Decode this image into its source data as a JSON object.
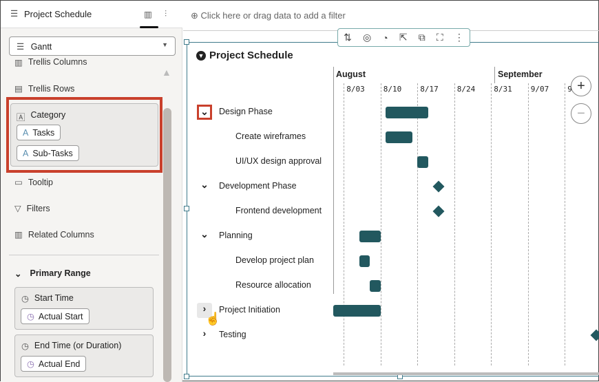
{
  "sidebar": {
    "title": "Project Schedule",
    "viz_type": "Gantt",
    "items": {
      "trellis_columns": "Trellis Columns",
      "trellis_rows": "Trellis Rows",
      "category": "Category",
      "tooltip": "Tooltip",
      "filters": "Filters",
      "related_columns": "Related Columns"
    },
    "category_pills": [
      "Tasks",
      "Sub-Tasks"
    ],
    "primary_range": {
      "title": "Primary Range",
      "start_label": "Start Time",
      "start_value": "Actual Start",
      "end_label": "End Time (or Duration)",
      "end_value": "Actual End"
    }
  },
  "filter_bar": {
    "placeholder": "Click here or drag data to add a filter"
  },
  "chart": {
    "title": "Project Schedule",
    "months": [
      "August",
      "September"
    ],
    "weeks": [
      "8/03",
      "8/10",
      "8/17",
      "8/24",
      "8/31",
      "9/07",
      "9/"
    ],
    "accent": "#22585f",
    "highlight": "#c9402c",
    "rows": [
      {
        "label": "Design Phase",
        "level": 0,
        "expander": "expanded",
        "start": "08-11",
        "end": "08-19"
      },
      {
        "label": "Create wireframes",
        "level": 1,
        "start": "08-11",
        "end": "08-16"
      },
      {
        "label": "UI/UX design approval",
        "level": 1,
        "start": "08-17",
        "end": "08-19"
      },
      {
        "label": "Development Phase",
        "level": 0,
        "expander": "expanded",
        "milestone": "08-21"
      },
      {
        "label": "Frontend development",
        "level": 1,
        "milestone": "08-21"
      },
      {
        "label": "Planning",
        "level": 0,
        "expander": "expanded",
        "start": "08-06",
        "end": "08-10"
      },
      {
        "label": "Develop project plan",
        "level": 1,
        "start": "08-06",
        "end": "08-08"
      },
      {
        "label": "Resource allocation",
        "level": 1,
        "start": "08-08",
        "end": "08-10"
      },
      {
        "label": "Project Initiation",
        "level": 0,
        "expander": "collapsed",
        "start": "08-01",
        "end": "08-10"
      },
      {
        "label": "Testing",
        "level": 0,
        "expander": "collapsed",
        "milestone": "09-20"
      }
    ]
  }
}
